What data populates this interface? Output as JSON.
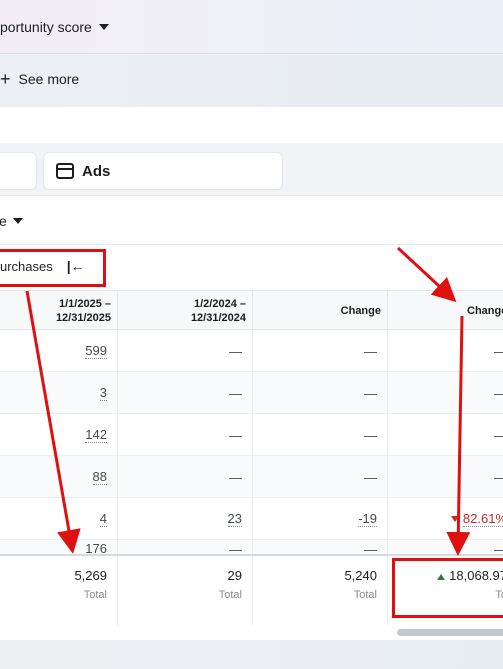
{
  "topbar": {
    "opportunity_label": "portunity score",
    "see_more_label": "See more"
  },
  "tabs": {
    "ads_label": "Ads"
  },
  "filter": {
    "partial_label": "e"
  },
  "table": {
    "metric_header": "urchases",
    "columns": {
      "current_range": "1/1/2025 –\n12/31/2025",
      "previous_range": "1/2/2024 –\n12/31/2024",
      "change": "Change",
      "change_pct": "Change("
    },
    "rows": [
      {
        "current": "599",
        "previous": "—",
        "change": "—",
        "change_pct": "—"
      },
      {
        "current": "3",
        "previous": "—",
        "change": "—",
        "change_pct": "—"
      },
      {
        "current": "142",
        "previous": "—",
        "change": "—",
        "change_pct": "—"
      },
      {
        "current": "88",
        "previous": "—",
        "change": "—",
        "change_pct": "—"
      },
      {
        "current": "4",
        "previous": "23",
        "change": "-19",
        "change_pct": "82.61%"
      },
      {
        "current": "176",
        "previous": "—",
        "change": "—",
        "change_pct": "—"
      }
    ],
    "totals": {
      "current": "5,269",
      "previous": "29",
      "change": "5,240",
      "change_pct": "18,068.97",
      "label": "Total",
      "label_partial": "To"
    }
  },
  "colors": {
    "annotation_red": "#e01010",
    "positive_green": "#2e7d32",
    "negative_red": "#c62828"
  }
}
